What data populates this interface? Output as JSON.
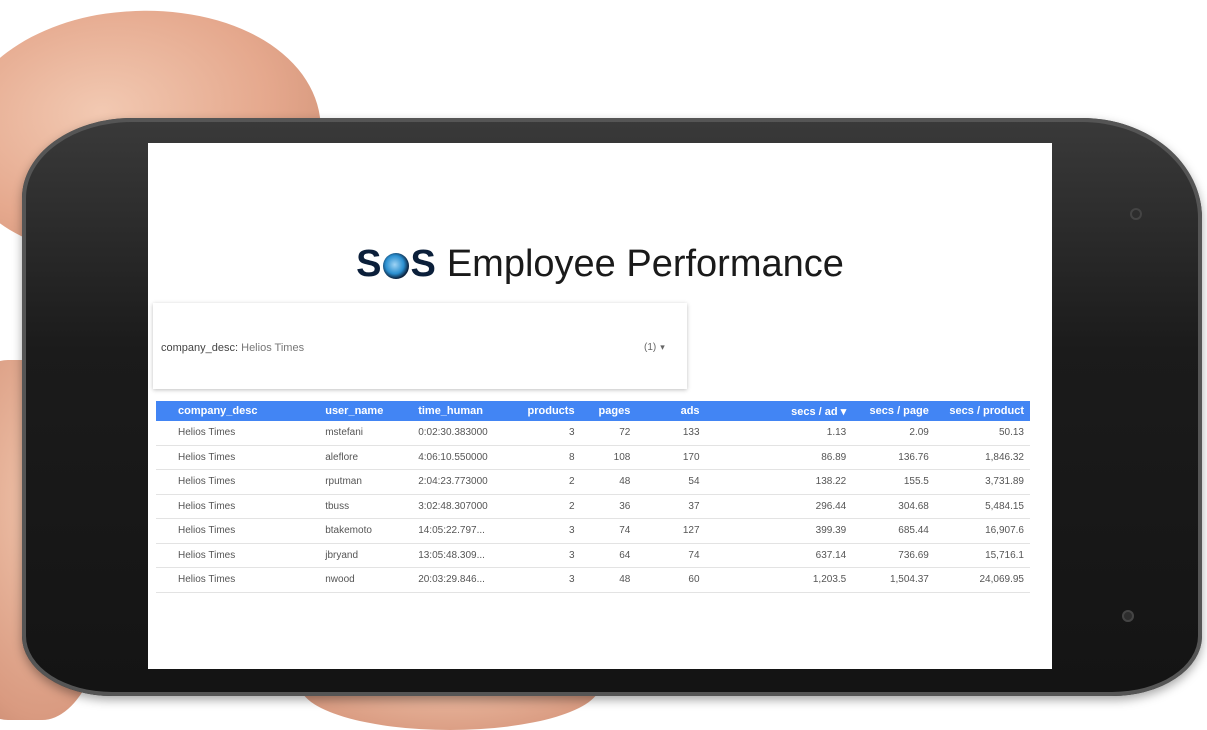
{
  "dashboard": {
    "logo_text_left": "S",
    "logo_text_right": "S",
    "title": "Employee Performance"
  },
  "filter": {
    "label": "company_desc",
    "value": "Helios Times",
    "count": "(1)",
    "caret": "▾"
  },
  "table": {
    "columns": [
      "company_desc",
      "user_name",
      "time_human",
      "products",
      "pages",
      "ads",
      "secs / ad",
      "secs / page",
      "secs / product"
    ],
    "sort_indicator": "▾",
    "rows": [
      [
        "Helios Times",
        "mstefani",
        "0:02:30.383000",
        "3",
        "72",
        "133",
        "1.13",
        "2.09",
        "50.13"
      ],
      [
        "Helios Times",
        "aleflore",
        "4:06:10.550000",
        "8",
        "108",
        "170",
        "86.89",
        "136.76",
        "1,846.32"
      ],
      [
        "Helios Times",
        "rputman",
        "2:04:23.773000",
        "2",
        "48",
        "54",
        "138.22",
        "155.5",
        "3,731.89"
      ],
      [
        "Helios Times",
        "tbuss",
        "3:02:48.307000",
        "2",
        "36",
        "37",
        "296.44",
        "304.68",
        "5,484.15"
      ],
      [
        "Helios Times",
        "btakemoto",
        "14:05:22.797...",
        "3",
        "74",
        "127",
        "399.39",
        "685.44",
        "16,907.6"
      ],
      [
        "Helios Times",
        "jbryand",
        "13:05:48.309...",
        "3",
        "64",
        "74",
        "637.14",
        "736.69",
        "15,716.1"
      ],
      [
        "Helios Times",
        "nwood",
        "20:03:29.846...",
        "3",
        "48",
        "60",
        "1,203.5",
        "1,504.37",
        "24,069.95"
      ]
    ]
  }
}
